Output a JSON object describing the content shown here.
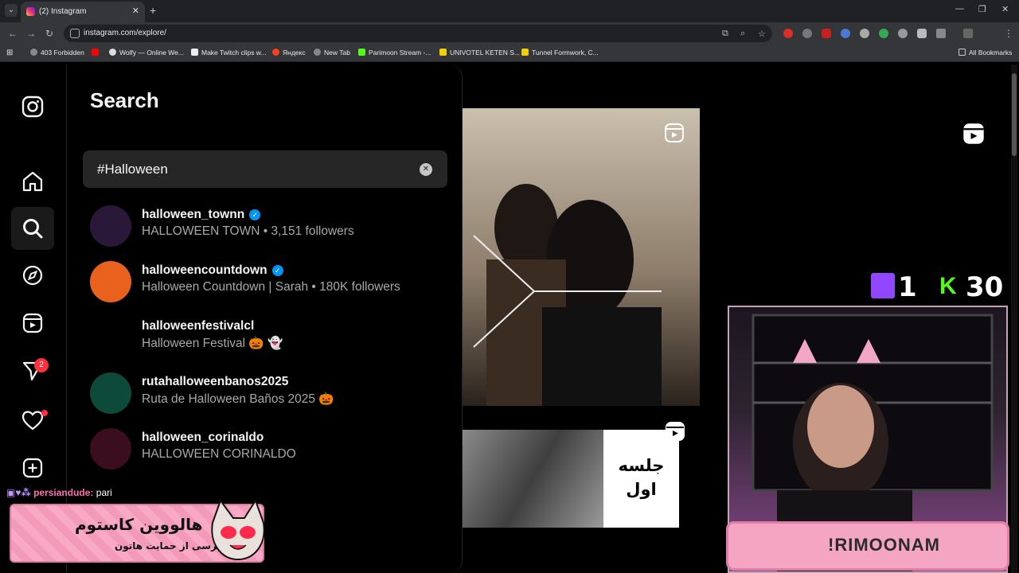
{
  "browser": {
    "tab_title": "(2) Instagram",
    "url": "instagram.com/explore/",
    "bookmarks": [
      "403 Forbidden",
      "Wolfy — Online We...",
      "Make Twitch clips w...",
      "Яндекс",
      "New Tab",
      "Parimoon Stream -...",
      "UNIVOTEL KETEN S...",
      "Tunnel Formwork, C..."
    ],
    "all_bookmarks": "All Bookmarks"
  },
  "sidenav": {
    "notifications_badge": "2"
  },
  "search": {
    "title": "Search",
    "query": "#Halloween",
    "results": [
      {
        "name": "halloween_townn",
        "verified": true,
        "subtitle": "HALLOWEEN TOWN • 3,151 followers",
        "avatar_color": "#2a1838"
      },
      {
        "name": "halloweencountdown",
        "verified": true,
        "subtitle": "Halloween Countdown | Sarah • 180K followers",
        "avatar_color": "#e8621d"
      },
      {
        "name": "halloweenfestivalcl",
        "verified": false,
        "subtitle": "Halloween Festival 🎃 👻",
        "avatar_color": "#000000"
      },
      {
        "name": "rutahalloweenbanos2025",
        "verified": false,
        "subtitle": "Ruta de Halloween Baños 2025 🎃",
        "avatar_color": "#0d4a3c"
      },
      {
        "name": "halloween_corinaldo",
        "verified": false,
        "subtitle": "HALLOWEEN CORINALDO",
        "avatar_color": "#3a0d1f"
      }
    ]
  },
  "explore": {
    "post2_text_line1": "جلسه",
    "post2_text_line2": "اول"
  },
  "stream": {
    "twitch_count": "1",
    "kick_count": "30",
    "streamer_name": "!RIMOONAM",
    "chat_user": "persiandude:",
    "chat_message": "pari",
    "promo_title": "هالووین کاستوم",
    "promo_subtitle": "مرسی از حمایت هاتون"
  },
  "colors": {
    "verified": "#0095f6",
    "badge": "#ff3040",
    "twitch": "#9146ff",
    "kick": "#53fc18"
  }
}
